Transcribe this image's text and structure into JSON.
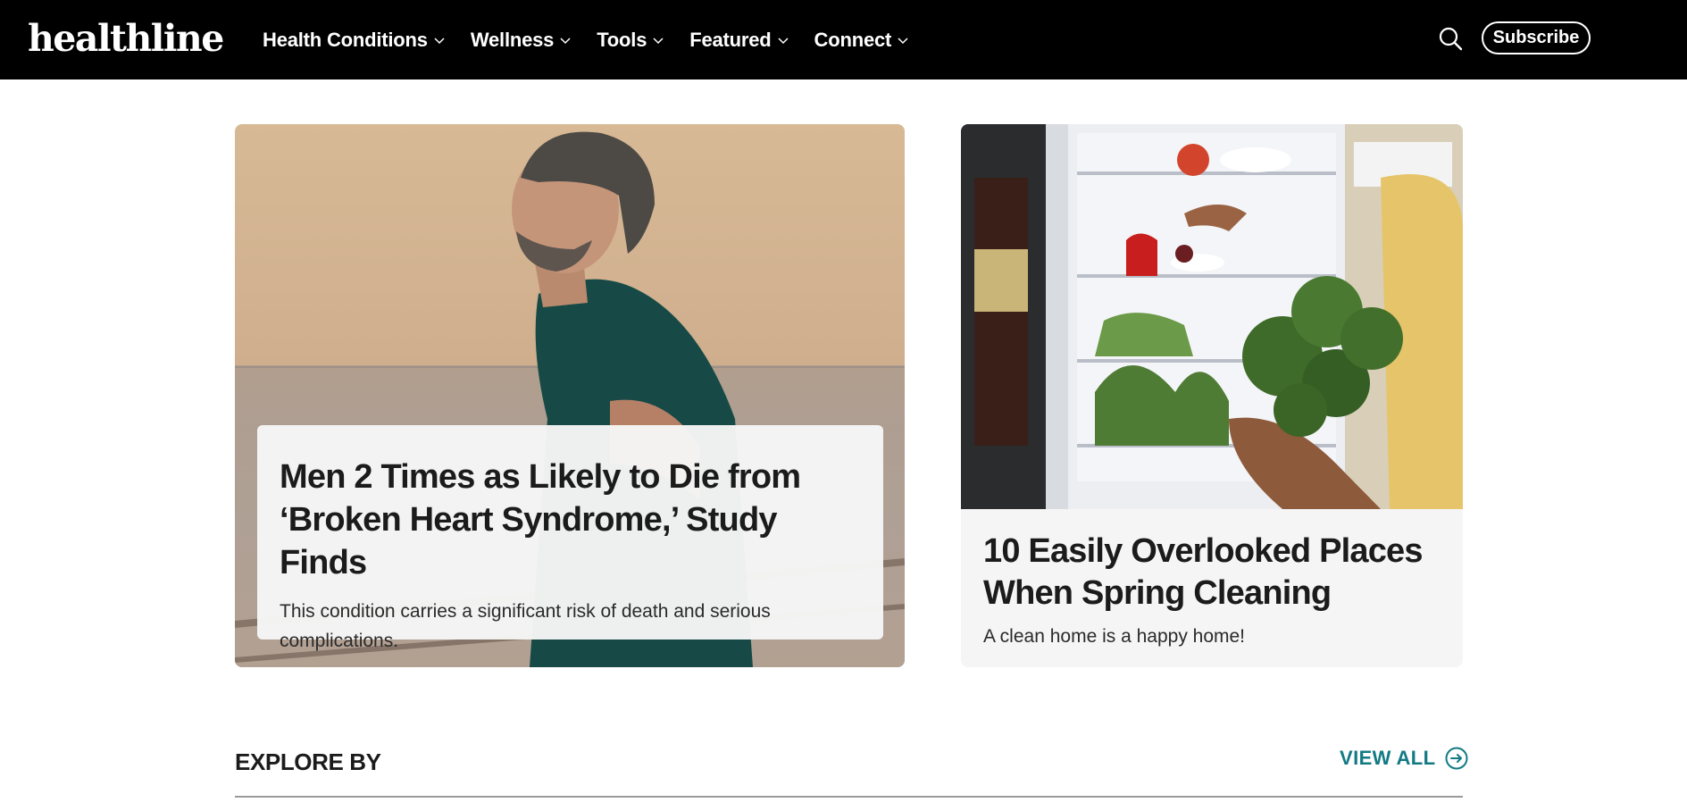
{
  "header": {
    "logo": "healthline",
    "nav": [
      {
        "label": "Health Conditions"
      },
      {
        "label": "Wellness"
      },
      {
        "label": "Tools"
      },
      {
        "label": "Featured"
      },
      {
        "label": "Connect"
      }
    ],
    "search_icon": "search-icon",
    "subscribe_label": "Subscribe"
  },
  "hero": {
    "title": "Men 2 Times as Likely to Die from ‘Broken Heart Syndrome,’ Study Finds",
    "description": "This condition carries a significant risk of death and serious complications."
  },
  "card2": {
    "title": "10 Easily Overlooked Places When Spring Cleaning",
    "description": "A clean home is a happy home!"
  },
  "explore": {
    "heading": "EXPLORE BY",
    "view_all": "VIEW ALL",
    "view_all_icon": "arrow-circle-icon"
  },
  "colors": {
    "header_bg": "#000000",
    "accent_teal": "#137a84",
    "card_bg": "#f5f5f5"
  }
}
